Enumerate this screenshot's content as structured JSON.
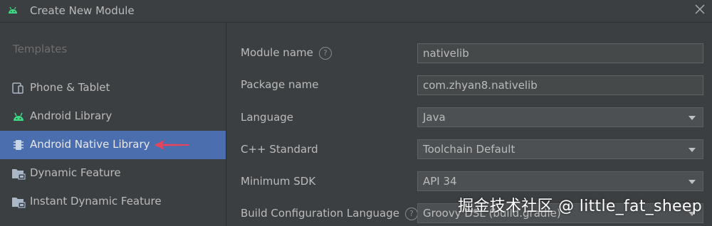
{
  "window": {
    "title": "Create New Module",
    "app_icon": "android-icon",
    "close_icon": "close-icon"
  },
  "sidebar": {
    "heading": "Templates",
    "items": [
      {
        "label": "Phone & Tablet",
        "icon": "phone-tablet-icon",
        "selected": false
      },
      {
        "label": "Android Library",
        "icon": "android-icon",
        "selected": false
      },
      {
        "label": "Android Native Library",
        "icon": "chip-icon",
        "selected": true
      },
      {
        "label": "Dynamic Feature",
        "icon": "folder-module-icon",
        "selected": false
      },
      {
        "label": "Instant Dynamic Feature",
        "icon": "folder-module-icon",
        "selected": false
      }
    ]
  },
  "form": {
    "module_name": {
      "label": "Module name",
      "value": "nativelib",
      "help": "?"
    },
    "package_name": {
      "label": "Package name",
      "value": "com.zhyan8.nativelib"
    },
    "language": {
      "label": "Language",
      "value": "Java"
    },
    "cpp_standard": {
      "label": "C++ Standard",
      "value": "Toolchain Default"
    },
    "min_sdk": {
      "label": "Minimum SDK",
      "value": "API 34"
    },
    "build_config": {
      "label": "Build Configuration Language",
      "value": "Groovy DSL (build.gradle)",
      "help": "?"
    }
  },
  "watermark": "掘金技术社区 @ little_fat_sheep",
  "colors": {
    "selection": "#4b6eaf",
    "arrow": "#e8435a",
    "android": "#3ddc84"
  }
}
